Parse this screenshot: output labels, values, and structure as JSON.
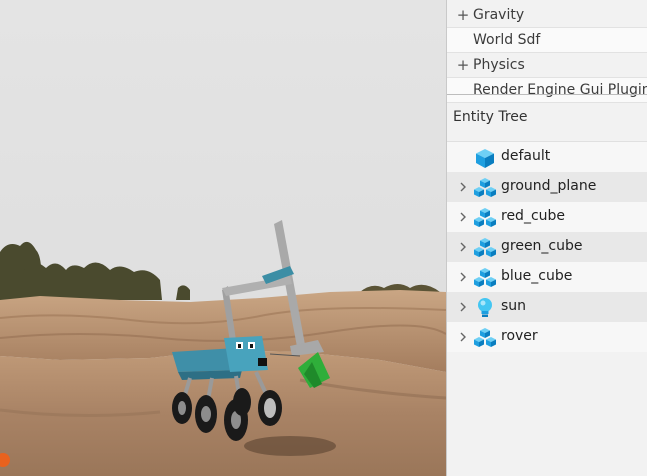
{
  "properties": {
    "rows": [
      {
        "toggle": "+",
        "label": "Gravity"
      },
      {
        "toggle": "",
        "label": "World Sdf"
      },
      {
        "toggle": "+",
        "label": "Physics"
      },
      {
        "toggle": "",
        "label": "Render Engine Gui Plugin"
      }
    ]
  },
  "entity_tree": {
    "title": "Entity Tree",
    "items": [
      {
        "label": "default",
        "icon": "model-cube-icon",
        "expandable": false
      },
      {
        "label": "ground_plane",
        "icon": "model-link-icon",
        "expandable": true
      },
      {
        "label": "red_cube",
        "icon": "model-link-icon",
        "expandable": true
      },
      {
        "label": "green_cube",
        "icon": "model-link-icon",
        "expandable": true
      },
      {
        "label": "blue_cube",
        "icon": "model-link-icon",
        "expandable": true
      },
      {
        "label": "sun",
        "icon": "light-bulb-icon",
        "expandable": true
      },
      {
        "label": "rover",
        "icon": "model-link-icon",
        "expandable": true
      }
    ]
  },
  "colors": {
    "sky": "#e3e3e3",
    "terrain": "#b8906e",
    "rover_body": "#3f8fa8",
    "gripper": "#2fae3a",
    "icon_blue": "#1ea0e0"
  }
}
